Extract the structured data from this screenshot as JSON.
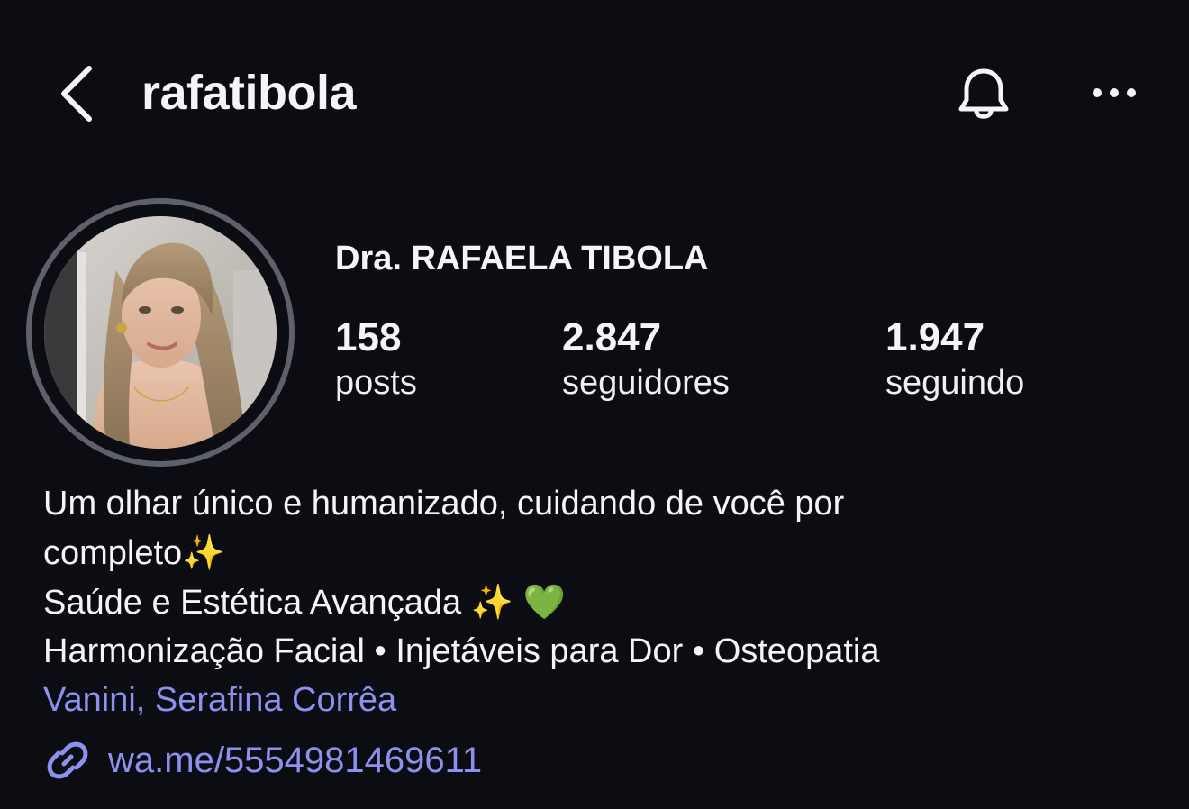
{
  "header": {
    "username": "rafatibola",
    "back_icon": "chevron-left-icon",
    "bell_icon": "bell-icon",
    "more_icon": "more-horizontal-icon"
  },
  "profile": {
    "full_name": "Dra. RAFAELA TIBOLA",
    "stats": [
      {
        "value": "158",
        "label": "posts"
      },
      {
        "value": "2.847",
        "label": "seguidores"
      },
      {
        "value": "1.947",
        "label": "seguindo"
      }
    ]
  },
  "bio": {
    "line1": "Um olhar único e humanizado, cuidando de você por",
    "line2_text": "completo",
    "line2_emoji": "✨",
    "line3_text": "Saúde e Estética Avançada ",
    "line3_emoji1": "✨",
    "line3_emoji2": "💚",
    "line4": "Harmonização Facial • Injetáveis para Dor • Osteopatia",
    "location": "Vanini, Serafina Corrêa"
  },
  "link": {
    "icon": "link-icon",
    "text": "wa.me/5554981469611"
  },
  "colors": {
    "background": "#0c0d12",
    "text": "#f5f5f7",
    "accent_link": "#8c90ee",
    "ring": "#5e606a"
  }
}
